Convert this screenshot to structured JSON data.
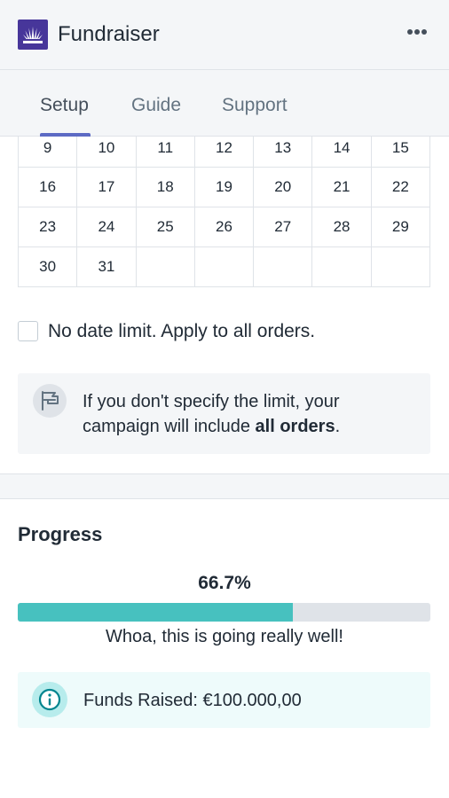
{
  "app": {
    "title": "Fundraiser",
    "logo_icon": "fan-logo-icon",
    "more_icon": "more-horizontal-icon",
    "brand_color": "#47369a"
  },
  "tabs": [
    {
      "label": "Setup",
      "active": true
    },
    {
      "label": "Guide",
      "active": false
    },
    {
      "label": "Support",
      "active": false
    }
  ],
  "calendar": {
    "weeks": [
      [
        "9",
        "10",
        "11",
        "12",
        "13",
        "14",
        "15"
      ],
      [
        "16",
        "17",
        "18",
        "19",
        "20",
        "21",
        "22"
      ],
      [
        "23",
        "24",
        "25",
        "26",
        "27",
        "28",
        "29"
      ],
      [
        "30",
        "31",
        "",
        "",
        "",
        "",
        ""
      ]
    ]
  },
  "date_limit": {
    "checkbox_label": "No date limit. Apply to all orders.",
    "checked": false
  },
  "limit_banner": {
    "icon": "flag-icon",
    "text_prefix": "If you don't specify the limit, your campaign will include ",
    "text_bold": "all orders",
    "text_suffix": "."
  },
  "progress": {
    "heading": "Progress",
    "percent_label": "66.7%",
    "fraction": 0.667,
    "message": "Whoa, this is going really well!",
    "bar_color": "#47c1bf"
  },
  "funds_banner": {
    "icon": "info-icon",
    "text": "Funds Raised: €100.000,00"
  }
}
